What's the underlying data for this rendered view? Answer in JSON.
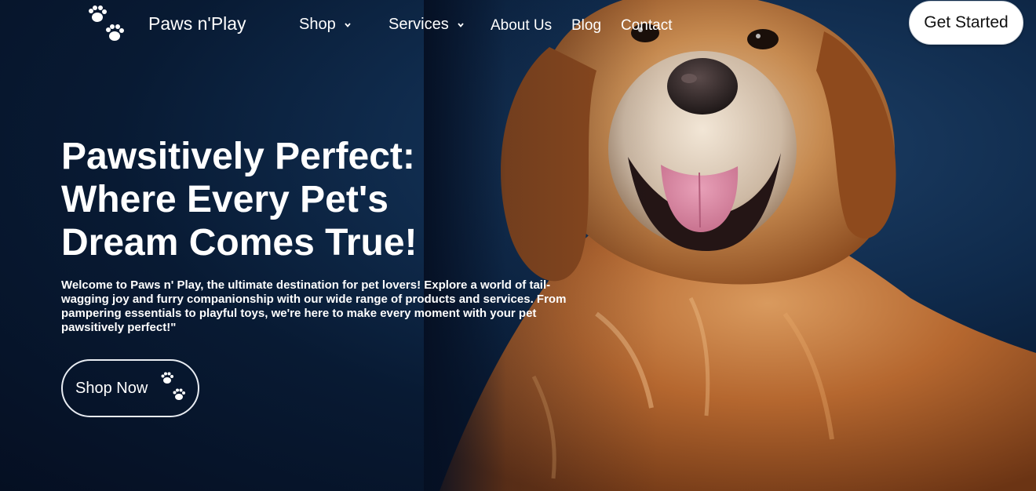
{
  "header": {
    "brand": "Paws n'Play",
    "logo_icon": "paw-prints-icon",
    "nav": [
      {
        "label": "Shop",
        "has_dropdown": true
      },
      {
        "label": "Services",
        "has_dropdown": true
      },
      {
        "label": "About Us",
        "has_dropdown": false
      },
      {
        "label": "Blog",
        "has_dropdown": false
      },
      {
        "label": "Contact",
        "has_dropdown": false
      }
    ],
    "cta_label": "Get Started"
  },
  "hero": {
    "headline": "Pawsitively Perfect: Where Every Pet's Dream Comes True!",
    "subtext": "Welcome to Paws n' Play, the ultimate destination for pet lovers! Explore a world of tail-wagging joy and furry companionship with our wide range of products and services. From pampering essentials to playful toys, we're here to make every moment with your pet pawsitively perfect!\"",
    "button_label": "Shop Now",
    "button_icon": "paw-prints-icon",
    "image": "golden-retriever-photo"
  },
  "colors": {
    "background": "#0b2142",
    "text": "#ffffff",
    "cta_background": "#ffffff",
    "dog_fur": "#b86a34"
  }
}
